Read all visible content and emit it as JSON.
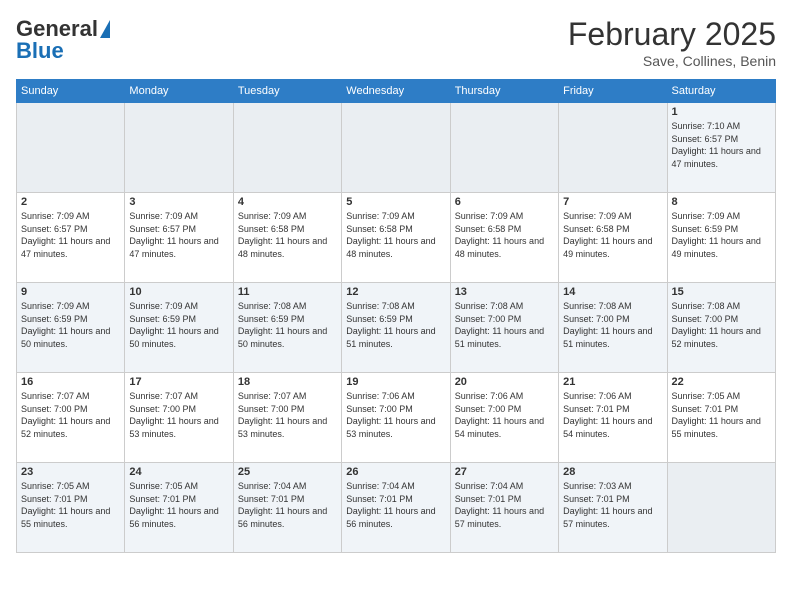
{
  "logo": {
    "text1": "General",
    "text2": "Blue"
  },
  "header": {
    "month": "February 2025",
    "location": "Save, Collines, Benin"
  },
  "weekdays": [
    "Sunday",
    "Monday",
    "Tuesday",
    "Wednesday",
    "Thursday",
    "Friday",
    "Saturday"
  ],
  "weeks": [
    [
      {
        "day": "",
        "empty": true
      },
      {
        "day": "",
        "empty": true
      },
      {
        "day": "",
        "empty": true
      },
      {
        "day": "",
        "empty": true
      },
      {
        "day": "",
        "empty": true
      },
      {
        "day": "",
        "empty": true
      },
      {
        "day": "1",
        "sunrise": "7:10 AM",
        "sunset": "6:57 PM",
        "daylight": "11 hours and 47 minutes."
      }
    ],
    [
      {
        "day": "2",
        "sunrise": "7:09 AM",
        "sunset": "6:57 PM",
        "daylight": "11 hours and 47 minutes."
      },
      {
        "day": "3",
        "sunrise": "7:09 AM",
        "sunset": "6:57 PM",
        "daylight": "11 hours and 47 minutes."
      },
      {
        "day": "4",
        "sunrise": "7:09 AM",
        "sunset": "6:58 PM",
        "daylight": "11 hours and 48 minutes."
      },
      {
        "day": "5",
        "sunrise": "7:09 AM",
        "sunset": "6:58 PM",
        "daylight": "11 hours and 48 minutes."
      },
      {
        "day": "6",
        "sunrise": "7:09 AM",
        "sunset": "6:58 PM",
        "daylight": "11 hours and 48 minutes."
      },
      {
        "day": "7",
        "sunrise": "7:09 AM",
        "sunset": "6:58 PM",
        "daylight": "11 hours and 49 minutes."
      },
      {
        "day": "8",
        "sunrise": "7:09 AM",
        "sunset": "6:59 PM",
        "daylight": "11 hours and 49 minutes."
      }
    ],
    [
      {
        "day": "9",
        "sunrise": "7:09 AM",
        "sunset": "6:59 PM",
        "daylight": "11 hours and 50 minutes."
      },
      {
        "day": "10",
        "sunrise": "7:09 AM",
        "sunset": "6:59 PM",
        "daylight": "11 hours and 50 minutes."
      },
      {
        "day": "11",
        "sunrise": "7:08 AM",
        "sunset": "6:59 PM",
        "daylight": "11 hours and 50 minutes."
      },
      {
        "day": "12",
        "sunrise": "7:08 AM",
        "sunset": "6:59 PM",
        "daylight": "11 hours and 51 minutes."
      },
      {
        "day": "13",
        "sunrise": "7:08 AM",
        "sunset": "7:00 PM",
        "daylight": "11 hours and 51 minutes."
      },
      {
        "day": "14",
        "sunrise": "7:08 AM",
        "sunset": "7:00 PM",
        "daylight": "11 hours and 51 minutes."
      },
      {
        "day": "15",
        "sunrise": "7:08 AM",
        "sunset": "7:00 PM",
        "daylight": "11 hours and 52 minutes."
      }
    ],
    [
      {
        "day": "16",
        "sunrise": "7:07 AM",
        "sunset": "7:00 PM",
        "daylight": "11 hours and 52 minutes."
      },
      {
        "day": "17",
        "sunrise": "7:07 AM",
        "sunset": "7:00 PM",
        "daylight": "11 hours and 53 minutes."
      },
      {
        "day": "18",
        "sunrise": "7:07 AM",
        "sunset": "7:00 PM",
        "daylight": "11 hours and 53 minutes."
      },
      {
        "day": "19",
        "sunrise": "7:06 AM",
        "sunset": "7:00 PM",
        "daylight": "11 hours and 53 minutes."
      },
      {
        "day": "20",
        "sunrise": "7:06 AM",
        "sunset": "7:00 PM",
        "daylight": "11 hours and 54 minutes."
      },
      {
        "day": "21",
        "sunrise": "7:06 AM",
        "sunset": "7:01 PM",
        "daylight": "11 hours and 54 minutes."
      },
      {
        "day": "22",
        "sunrise": "7:05 AM",
        "sunset": "7:01 PM",
        "daylight": "11 hours and 55 minutes."
      }
    ],
    [
      {
        "day": "23",
        "sunrise": "7:05 AM",
        "sunset": "7:01 PM",
        "daylight": "11 hours and 55 minutes."
      },
      {
        "day": "24",
        "sunrise": "7:05 AM",
        "sunset": "7:01 PM",
        "daylight": "11 hours and 56 minutes."
      },
      {
        "day": "25",
        "sunrise": "7:04 AM",
        "sunset": "7:01 PM",
        "daylight": "11 hours and 56 minutes."
      },
      {
        "day": "26",
        "sunrise": "7:04 AM",
        "sunset": "7:01 PM",
        "daylight": "11 hours and 56 minutes."
      },
      {
        "day": "27",
        "sunrise": "7:04 AM",
        "sunset": "7:01 PM",
        "daylight": "11 hours and 57 minutes."
      },
      {
        "day": "28",
        "sunrise": "7:03 AM",
        "sunset": "7:01 PM",
        "daylight": "11 hours and 57 minutes."
      },
      {
        "day": "",
        "empty": true
      }
    ]
  ],
  "labels": {
    "sunrise": "Sunrise:",
    "sunset": "Sunset:",
    "daylight": "Daylight:"
  }
}
